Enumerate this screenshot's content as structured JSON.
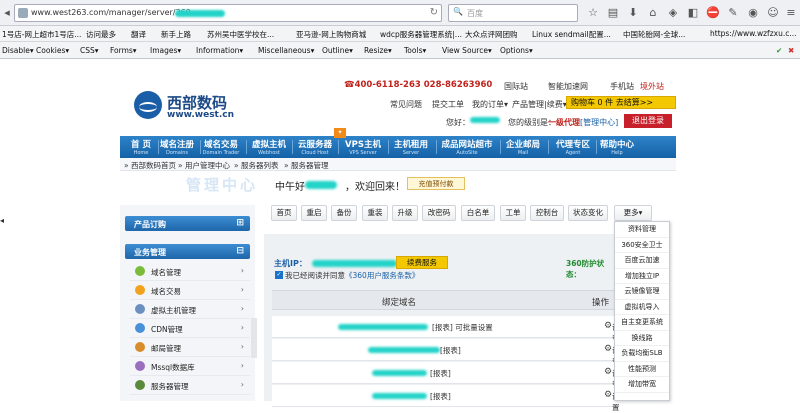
{
  "browser": {
    "url": "www.west263.com/manager/server/360.",
    "search_placeholder": "百度",
    "bookmarks": [
      "1号店-网上超市1号店...",
      "访问最多",
      "翻译",
      "新手上路",
      "苏州吴中医学校在...",
      "亚马逊-网上购物商城",
      "wdcp服务器管理系统|...",
      "大众点评网团购",
      "Linux sendmail配置...",
      "中国轮胎网-全球...",
      "https://www.wzfzxu.c..."
    ],
    "dev_toolbar": [
      "Disable▾",
      "Cookies▾",
      "CSS▾",
      "Forms▾",
      "Images▾",
      "Information▾",
      "Miscellaneous▾",
      "Outline▾",
      "Resize▾",
      "Tools▾",
      "View Source▾",
      "Options▾"
    ]
  },
  "header": {
    "logo_name": "西部数码",
    "logo_url": "www.west.cn",
    "phones": "☎400-6118-263  028-86263960",
    "links": [
      "国际站",
      "智能加速网",
      "手机站",
      "境外站"
    ],
    "sublinks": [
      "常见问题",
      "提交工单",
      "我的订单▾",
      "产品管理|续费▾"
    ],
    "cart": "购物车 0 件 去结算>>",
    "user_line": "您好：",
    "level_label": "您的级别是：",
    "level_value": "一级代理",
    "manage": "[管理中心]",
    "logout": "退出登录"
  },
  "nav": [
    {
      "cn": "首 页",
      "en": "Home"
    },
    {
      "cn": "域名注册",
      "en": "Domains"
    },
    {
      "cn": "域名交易",
      "en": "Domain Trader"
    },
    {
      "cn": "虚拟主机",
      "en": "Webhost"
    },
    {
      "cn": "云服务器",
      "en": "Cloud Host"
    },
    {
      "cn": "VPS主机",
      "en": "VPS Server"
    },
    {
      "cn": "主机租用",
      "en": "Server"
    },
    {
      "cn": "成品网站超市",
      "en": "AutoSite"
    },
    {
      "cn": "企业邮局",
      "en": "Mail"
    },
    {
      "cn": "代理专区",
      "en": "Agent"
    },
    {
      "cn": "帮助中心",
      "en": "Help"
    }
  ],
  "breadcrumb": [
    "西部数码首页",
    "用户管理中心",
    "服务器列表",
    "服务器管理"
  ],
  "sidebar": {
    "watermark": "管理中心",
    "sections": [
      {
        "label": "产品订购",
        "mark": "⊞"
      },
      {
        "label": "业务管理",
        "mark": "⊟"
      }
    ],
    "items": [
      {
        "label": "域名管理",
        "color": "#7bbb3a"
      },
      {
        "label": "域名交易",
        "color": "#f2a21c"
      },
      {
        "label": "虚拟主机管理",
        "color": "#6b8fbf"
      },
      {
        "label": "CDN管理",
        "color": "#4a90d9"
      },
      {
        "label": "邮局管理",
        "color": "#d98c2a"
      },
      {
        "label": "Mssql数据库",
        "color": "#9a6fc0"
      },
      {
        "label": "服务器管理",
        "color": "#5b8a3c"
      }
    ]
  },
  "main": {
    "greeting": "中午好",
    "welcome": "，欢迎回来！",
    "prepay": "充值预付款",
    "toolbar": [
      "首页",
      "重启",
      "备份",
      "重装",
      "升级",
      "改密码",
      "白名单",
      "工单",
      "控制台",
      "状态变化",
      "更多▾"
    ],
    "more_menu": [
      "资料管理",
      "360安全卫士",
      "百度云加速",
      "增加独立IP",
      "云镜像管理",
      "虚拟机导入",
      "自主变更系统",
      "换线路",
      "负载均衡SLB",
      "性能预测",
      "增加带宽",
      "..."
    ],
    "host_ip_label": "主机IP：",
    "renew": "续费服务",
    "agree_text": "我已经阅读并同意",
    "agree_link": "《360用户服务条款》",
    "status": "360防护状态：",
    "col_domain": "绑定域名",
    "col_ops": "操作",
    "rows": [
      {
        "tag": "[报表]  可批量设置"
      },
      {
        "tag": "[报表]"
      },
      {
        "tag": "[报表]"
      },
      {
        "tag": "[报表]"
      },
      {
        "tag": "[报表]"
      }
    ],
    "setting": "设置"
  }
}
